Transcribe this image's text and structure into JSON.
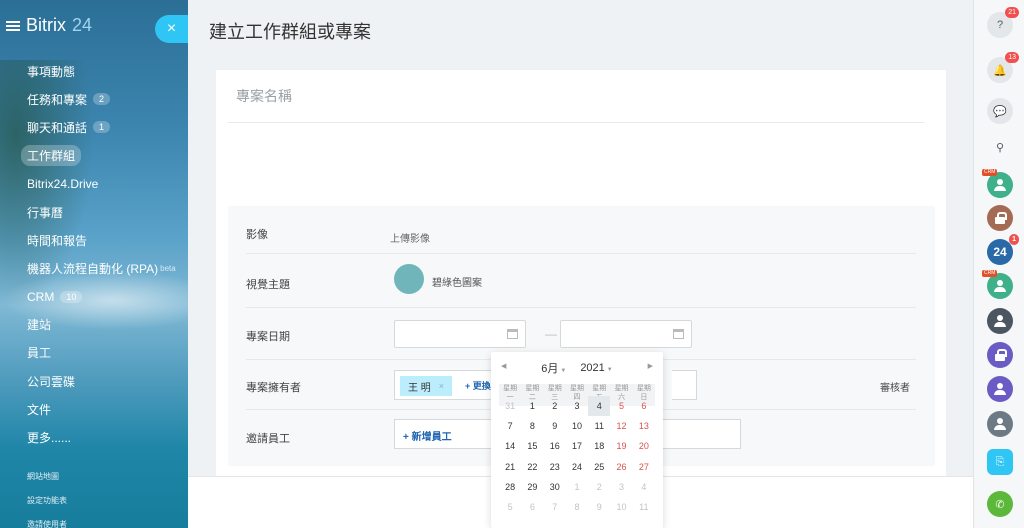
{
  "sidebar": {
    "logo": {
      "name": "Bitrix",
      "suffix": "24"
    },
    "items": [
      {
        "label": "事項動態",
        "count": ""
      },
      {
        "label": "任務和專案",
        "count": "2"
      },
      {
        "label": "聊天和通話",
        "count": "1"
      },
      {
        "label": "工作群組",
        "count": "",
        "active": true
      },
      {
        "label": "Bitrix24.Drive",
        "count": ""
      },
      {
        "label": "行事曆",
        "count": ""
      },
      {
        "label": "時間和報告",
        "count": ""
      },
      {
        "label": "機器人流程自動化 (RPA)",
        "count": "",
        "sup": "beta"
      },
      {
        "label": "CRM",
        "count": "10"
      },
      {
        "label": "建站",
        "count": ""
      },
      {
        "label": "員工",
        "count": ""
      },
      {
        "label": "公司雲碟",
        "count": ""
      },
      {
        "label": "文件",
        "count": ""
      },
      {
        "label": "更多......",
        "count": ""
      }
    ],
    "sub_items": [
      "網站地圖",
      "設定功能表",
      "邀請使用者"
    ]
  },
  "close_label": "×",
  "page": {
    "title": "建立工作群組或專案",
    "name_placeholder": "專案名稱",
    "fields": {
      "image_label": "影像",
      "image_link": "上傳影像",
      "theme_label": "視覺主題",
      "theme_name": "碧綠色圖案",
      "date_label": "專案日期",
      "date_dash": "—",
      "owner_label": "專案擁有者",
      "owner_name": "王 明",
      "owner_remove": "×",
      "owner_change": "+ 更換擁",
      "reviewer_label": "審核者",
      "invite_label": "邀請員工",
      "invite_add": "+  新增員工"
    }
  },
  "calendar": {
    "month": "6月",
    "year": "2021",
    "prev": "◀",
    "next": "▶",
    "weekdays": [
      [
        "星期",
        "一"
      ],
      [
        "星期",
        "二"
      ],
      [
        "星期",
        "三"
      ],
      [
        "星期",
        "四"
      ],
      [
        "星期",
        "五"
      ],
      [
        "星期",
        "六"
      ],
      [
        "星期",
        "日"
      ]
    ],
    "days": [
      [
        "31",
        "1",
        "2",
        "3",
        "4",
        "5",
        "6"
      ],
      [
        "7",
        "8",
        "9",
        "10",
        "11",
        "12",
        "13"
      ],
      [
        "14",
        "15",
        "16",
        "17",
        "18",
        "19",
        "20"
      ],
      [
        "21",
        "22",
        "23",
        "24",
        "25",
        "26",
        "27"
      ],
      [
        "28",
        "29",
        "30",
        "1",
        "2",
        "3",
        "4"
      ],
      [
        "5",
        "6",
        "7",
        "8",
        "9",
        "10",
        "11"
      ]
    ],
    "today": "4"
  },
  "rightbar": {
    "help_badge": "21",
    "notify_badge": "13",
    "bitrix_badge": "1",
    "crm_tag": "CRM",
    "bitrix_label": "24",
    "icons": [
      "help-icon",
      "bell-icon",
      "chat-icon",
      "search-icon",
      "crm-contact-avatar",
      "lock-avatar",
      "bitrix24-avatar",
      "crm-contact-avatar",
      "user-photo-avatar",
      "lock-avatar",
      "user-avatar",
      "user-photo-avatar",
      "open-lines-icon",
      "phone-icon"
    ]
  },
  "colors": {
    "accent": "#2fc6f6",
    "link": "#2066b0",
    "theme": "#6fb5ba",
    "weekend": "#d9534f",
    "badge": "#f0514f"
  }
}
